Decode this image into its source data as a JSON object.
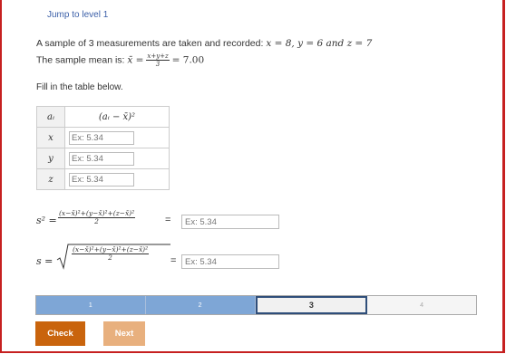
{
  "jump_link": "Jump to level 1",
  "problem": {
    "line1_prefix": "A sample of 3 measurements are taken and recorded: ",
    "line1_math": "x = 8, y = 6 and z = 7",
    "line2_prefix": "The sample mean is: ",
    "mean_symbol": "x̄ =",
    "mean_frac_num": "x+y+z",
    "mean_frac_den": "3",
    "mean_value": "= 7.00"
  },
  "instruction": "Fill in the table below.",
  "table": {
    "header_col1": "aᵢ",
    "header_col2": "(aᵢ − x̄)²",
    "rows": [
      {
        "label": "x",
        "placeholder": "Ex: 5.34"
      },
      {
        "label": "y",
        "placeholder": "Ex: 5.34"
      },
      {
        "label": "z",
        "placeholder": "Ex: 5.34"
      }
    ]
  },
  "variance": {
    "lhs": "s² =",
    "frac_num": "(x−x̄)²+(y−x̄)²+(z−x̄)²",
    "frac_den": "2",
    "eq": "=",
    "placeholder": "Ex: 5.34"
  },
  "stddev": {
    "lhs": "s =",
    "frac_num": "(x−x̄)²+(y−x̄)²+(z−x̄)²",
    "frac_den": "2",
    "eq": "=",
    "placeholder": "Ex: 5.34"
  },
  "progress": {
    "segments": [
      "1",
      "2",
      "3",
      "4"
    ],
    "current": 3
  },
  "buttons": {
    "check": "Check",
    "next": "Next"
  },
  "colors": {
    "accent": "#c9640d",
    "progress_done": "#7ea6d6",
    "link": "#3b5fa8"
  }
}
